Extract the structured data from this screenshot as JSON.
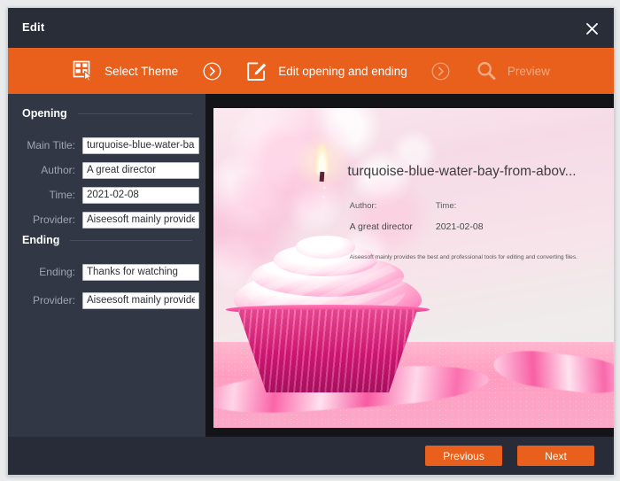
{
  "window": {
    "title": "Edit",
    "close_icon": "close-icon"
  },
  "stepbar": {
    "steps": [
      {
        "label": "Select Theme",
        "icon": "theme-grid-icon",
        "state": "active"
      },
      {
        "label": "Edit opening and ending",
        "icon": "edit-pencil-square-icon",
        "state": "active"
      },
      {
        "label": "Preview",
        "icon": "search-magnifier-icon",
        "state": "disabled"
      }
    ],
    "separator_icon": "chevron-right-circle-icon",
    "accent_color": "#e8601b"
  },
  "sidebar": {
    "sections": [
      {
        "title": "Opening"
      },
      {
        "title": "Ending"
      }
    ],
    "fields": [
      {
        "label": "Main Title:",
        "value": "turquoise-blue-water-ba",
        "placeholder": "Main Title"
      },
      {
        "label": "Author:",
        "value": "A great director",
        "placeholder": "Author"
      },
      {
        "label": "Time:",
        "value": "2021-02-08",
        "placeholder": "Time"
      },
      {
        "label": "Provider:",
        "value": "Aiseesoft mainly provide",
        "placeholder": "Provider"
      },
      {
        "label": "Ending:",
        "value": "Thanks for watching",
        "placeholder": "Ending"
      },
      {
        "label": "Provider:",
        "value": "Aiseesoft mainly provide",
        "placeholder": "Provider"
      }
    ]
  },
  "preview": {
    "overlay": {
      "title": "turquoise-blue-water-bay-from-abov...",
      "author_label": "Author:",
      "author_value": "A great director",
      "time_label": "Time:",
      "time_value": "2021-02-08",
      "description": "Aiseesoft mainly provides the best and professional tools for editing and converting files."
    }
  },
  "footer": {
    "previous_label": "Previous",
    "next_label": "Next"
  }
}
